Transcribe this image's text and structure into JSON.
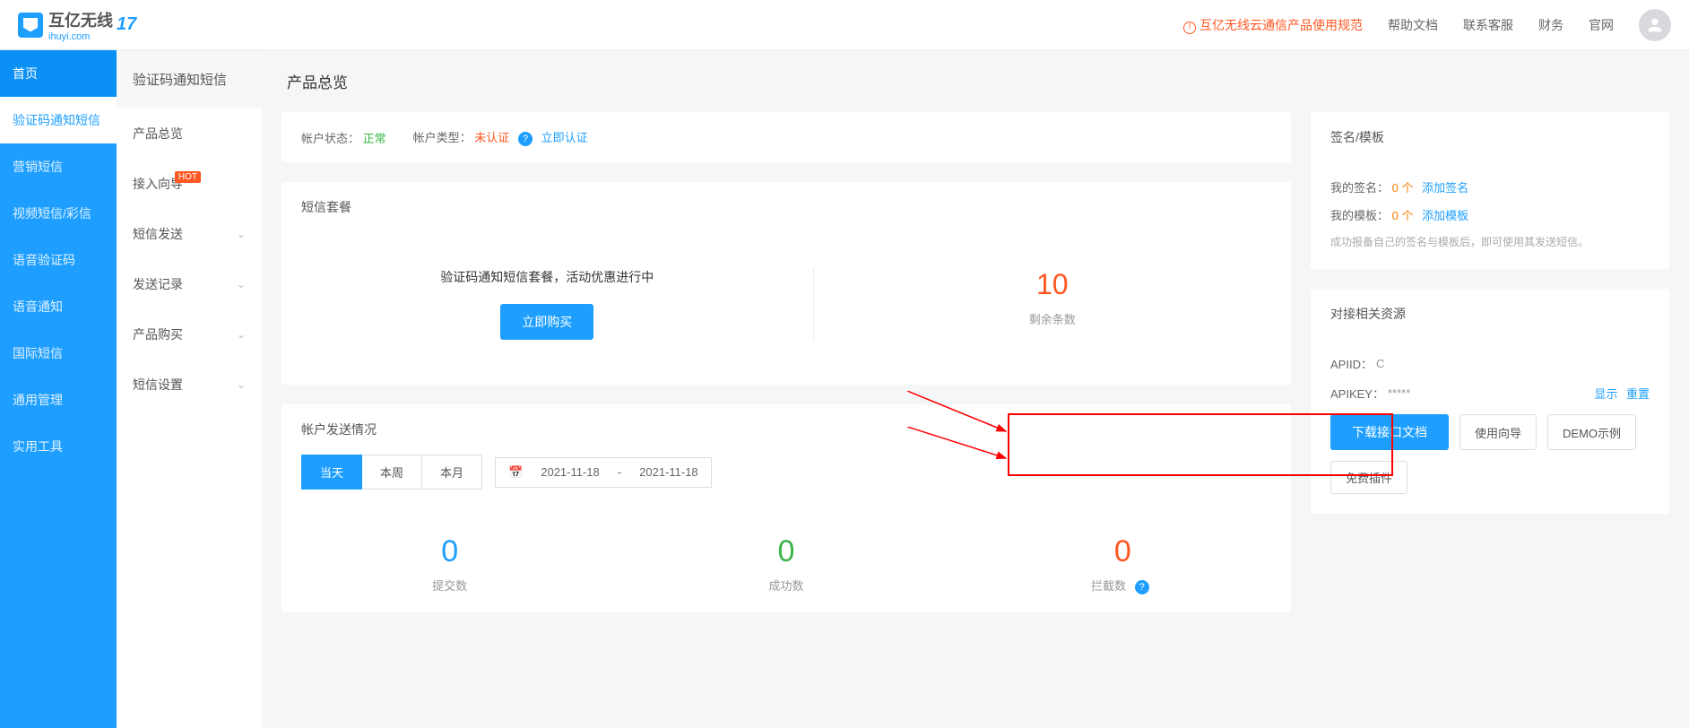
{
  "header": {
    "brand_cn": "互亿无线",
    "brand_en": "ihuyi.com",
    "badge": "17",
    "warn_link": "互亿无线云通信产品使用规范",
    "links": [
      "帮助文档",
      "联系客服",
      "财务",
      "官网"
    ]
  },
  "sidebar_primary": {
    "items": [
      "首页",
      "验证码通知短信",
      "营销短信",
      "视频短信/彩信",
      "语音验证码",
      "语音通知",
      "国际短信",
      "通用管理",
      "实用工具"
    ],
    "active_index": 1
  },
  "sidebar_secondary": {
    "title": "验证码通知短信",
    "items": [
      {
        "label": "产品总览",
        "expandable": false,
        "hot": false
      },
      {
        "label": "接入向导",
        "expandable": false,
        "hot": true
      },
      {
        "label": "短信发送",
        "expandable": true,
        "hot": false
      },
      {
        "label": "发送记录",
        "expandable": true,
        "hot": false
      },
      {
        "label": "产品购买",
        "expandable": true,
        "hot": false
      },
      {
        "label": "短信设置",
        "expandable": true,
        "hot": false
      }
    ]
  },
  "page": {
    "title": "产品总览"
  },
  "status": {
    "state_label": "帐户状态：",
    "state_value": "正常",
    "type_label": "帐户类型：",
    "type_value": "未认证",
    "verify_link": "立即认证"
  },
  "package": {
    "title": "短信套餐",
    "promo_text": "验证码通知短信套餐，活动优惠进行中",
    "buy_button": "立即购买",
    "remaining_num": "10",
    "remaining_label": "剩余条数"
  },
  "stats": {
    "title": "帐户发送情况",
    "tabs": [
      "当天",
      "本周",
      "本月"
    ],
    "active_tab": 0,
    "date_start": "2021-11-18",
    "date_sep": "-",
    "date_end": "2021-11-18",
    "items": [
      {
        "num": "0",
        "label": "提交数",
        "color": "blue"
      },
      {
        "num": "0",
        "label": "成功数",
        "color": "green"
      },
      {
        "num": "0",
        "label": "拦截数",
        "color": "red"
      }
    ]
  },
  "signtpl": {
    "title": "签名/模板",
    "sign_label": "我的签名：",
    "sign_count": "0 个",
    "sign_link": "添加签名",
    "tpl_label": "我的模板：",
    "tpl_count": "0 个",
    "tpl_link": "添加模板",
    "hint": "成功报备自己的签名与模板后，即可使用其发送短信。"
  },
  "resources": {
    "title": "对接相关资源",
    "apiid_label": "APIID：",
    "apiid_value": "C",
    "apikey_label": "APIKEY：",
    "apikey_value": "*****",
    "show": "显示",
    "reset": "重置",
    "buttons": [
      "下载接口文档",
      "使用向导",
      "DEMO示例",
      "免费插件"
    ]
  }
}
